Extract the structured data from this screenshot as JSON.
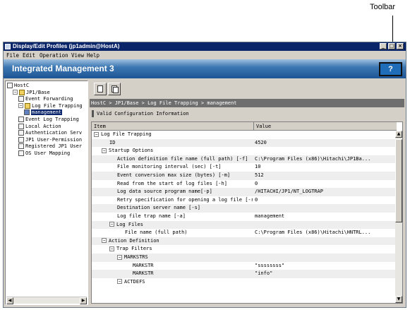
{
  "callout": {
    "label": "Toolbar"
  },
  "window": {
    "title": "Display/Edit Profiles (jp1admin@HostA)",
    "buttons": {
      "minimize": "_",
      "maximize": "□",
      "close": "×"
    }
  },
  "menu": [
    "File",
    "Edit",
    "Operation",
    "View",
    "Help"
  ],
  "banner": {
    "brand": "Integrated Management 3",
    "help_label": "?"
  },
  "tree": {
    "items": [
      {
        "label": "HostC",
        "indent": 0,
        "icon": "host-icon",
        "expander": ""
      },
      {
        "label": "JP1/Base",
        "indent": 1,
        "icon": "folder-icon",
        "expander": "−"
      },
      {
        "label": "Event Forwarding",
        "indent": 2,
        "icon": "document-icon",
        "expander": ""
      },
      {
        "label": "Log File Trapping",
        "indent": 2,
        "icon": "folder-icon",
        "expander": "−"
      },
      {
        "label": "management",
        "indent": 3,
        "icon": "document-icon",
        "expander": "",
        "selected": true
      },
      {
        "label": "Event Log Trapping",
        "indent": 2,
        "icon": "document-icon",
        "expander": ""
      },
      {
        "label": "Local Action",
        "indent": 2,
        "icon": "document-icon",
        "expander": ""
      },
      {
        "label": "Authentication Serv",
        "indent": 2,
        "icon": "document-icon",
        "expander": ""
      },
      {
        "label": "JP1 User-Permission",
        "indent": 2,
        "icon": "document-icon",
        "expander": ""
      },
      {
        "label": "Registered JP1 User",
        "indent": 2,
        "icon": "document-icon",
        "expander": ""
      },
      {
        "label": "OS User Mapping",
        "indent": 2,
        "icon": "document-icon",
        "expander": ""
      }
    ]
  },
  "breadcrumb": "HostC > JP1/Base > Log File Trapping > management",
  "section_label": "Valid Configuration Information",
  "table": {
    "columns": [
      "Item",
      "Value"
    ],
    "rows": [
      {
        "item": "Log File Trapping",
        "value": "",
        "indent": 0,
        "expander": "−"
      },
      {
        "item": "ID",
        "value": "4520",
        "indent": 2,
        "expander": ""
      },
      {
        "item": "Startup Options",
        "value": "",
        "indent": 1,
        "expander": "−"
      },
      {
        "item": "Action definition file name (full path) [-f]",
        "value": "C:\\Program Files (x86)\\Hitachi\\JP1Ba...",
        "indent": 3,
        "expander": ""
      },
      {
        "item": "File monitoring interval (sec) [-t]",
        "value": "10",
        "indent": 3,
        "expander": ""
      },
      {
        "item": "Event conversion max size (bytes) [-m]",
        "value": "512",
        "indent": 3,
        "expander": ""
      },
      {
        "item": "Read from the start of log files [-h]",
        "value": "0",
        "indent": 3,
        "expander": ""
      },
      {
        "item": "Log data source program name[-p]",
        "value": "/HITACHI/JP1/NT_LOGTRAP",
        "indent": 3,
        "expander": ""
      },
      {
        "item": "Retry specification for opening a log file [-r]",
        "value": "0",
        "indent": 3,
        "expander": ""
      },
      {
        "item": "Destination server name [-s]",
        "value": "",
        "indent": 3,
        "expander": ""
      },
      {
        "item": "Log file trap name [-a]",
        "value": "management",
        "indent": 3,
        "expander": ""
      },
      {
        "item": "Log Files",
        "value": "",
        "indent": 2,
        "expander": "−"
      },
      {
        "item": "File name (full path)",
        "value": "C:\\Program Files (x86)\\Hitachi\\HNTRL...",
        "indent": 4,
        "expander": ""
      },
      {
        "item": "Action Definition",
        "value": "",
        "indent": 1,
        "expander": "−"
      },
      {
        "item": "Trap Filters",
        "value": "",
        "indent": 2,
        "expander": "−"
      },
      {
        "item": "MARKSTRS",
        "value": "",
        "indent": 3,
        "expander": "−"
      },
      {
        "item": "MARKSTR",
        "value": "\"ssssssss\"",
        "indent": 5,
        "expander": ""
      },
      {
        "item": "MARKSTR",
        "value": "\"info\"",
        "indent": 5,
        "expander": ""
      },
      {
        "item": "ACTDEFS",
        "value": "",
        "indent": 3,
        "expander": "−"
      }
    ]
  },
  "colors": {
    "title_bar": "#0a246a",
    "banner": "#1d5594",
    "breadcrumb_bg": "#6e6e6e",
    "selection": "#0a246a"
  }
}
